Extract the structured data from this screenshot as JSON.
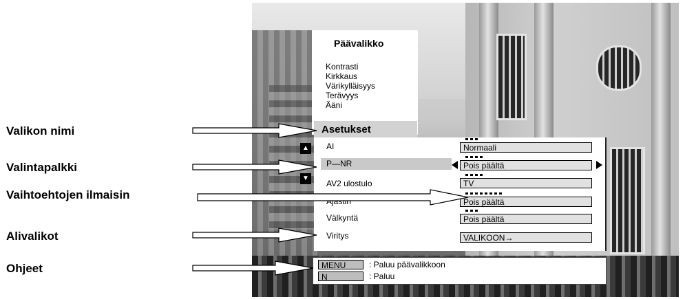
{
  "main_menu": {
    "title": "Päävalikko",
    "items": [
      "Kontrasti",
      "Kirkkaus",
      "Värikylläisyys",
      "Terävyys",
      "Ääni"
    ]
  },
  "settings_menu": {
    "title": "Asetukset",
    "options": [
      {
        "label": "AI",
        "value": "Normaali"
      },
      {
        "label": "P—NR",
        "value": "Pois päältä"
      },
      {
        "label": "AV2 ulostulo",
        "value": "TV"
      },
      {
        "label": "Ajastin",
        "value": "Pois päältä"
      },
      {
        "label": "Välkyntä",
        "value": "Pois päältä"
      },
      {
        "label": "Viritys",
        "value": "VALIKOON→"
      }
    ],
    "selected_index": 1
  },
  "help": {
    "keys": [
      {
        "key": "MENU",
        "text": ": Paluu päävalikkoon"
      },
      {
        "key": "N",
        "text": ": Paluu"
      }
    ]
  },
  "callouts": [
    "Valikon nimi",
    "Valintapalkki",
    "Vaihtoehtojen ilmaisin",
    "Alivalikot",
    "Ohjeet"
  ],
  "icons": {
    "scroll_up": "up-triangle-icon",
    "scroll_down": "down-triangle-icon",
    "value_prev": "left-triangle-icon",
    "value_next": "right-triangle-icon"
  }
}
